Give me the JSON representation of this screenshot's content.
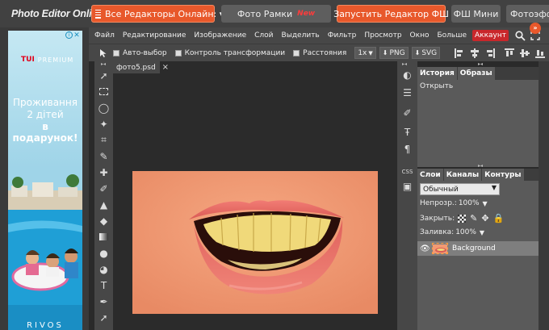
{
  "site": {
    "logo": "Photo Editor Online"
  },
  "topbar": {
    "all_editors": "Все Редакторы Онлайн: ▾",
    "frames": "Фото Рамки",
    "frames_badge": "New",
    "launch": "Запустить Редактор ФШ",
    "mini": "ФШ Мини",
    "effects": "Фотоэфф"
  },
  "ad": {
    "brand_mark": "TUI",
    "brand_text": "PREMIUM",
    "line1": "Проживання",
    "line2": "2 дітей",
    "line3": "в подарунок!",
    "footer": "RIVOS",
    "info": "i",
    "close": "✕"
  },
  "menu": {
    "items": [
      "Файл",
      "Редактирование",
      "Изображение",
      "Слой",
      "Выделить",
      "Фильтр",
      "Просмотр",
      "Окно",
      "Больше"
    ],
    "account": "Аккаунт"
  },
  "options": {
    "auto_select": "Авто-выбор",
    "transform": "Контроль трансформации",
    "distances": "Расстояния",
    "zoom": "1x",
    "png": "PNG",
    "svg": "SVG"
  },
  "document": {
    "tab": "фото5.psd",
    "close": "×"
  },
  "panels": {
    "history_tabs": [
      "История",
      "Образы"
    ],
    "history_items": [
      "Открыть"
    ],
    "layer_tabs": [
      "Слои",
      "Каналы",
      "Контуры"
    ],
    "blend_mode": "Обычный",
    "opacity_label": "Непрозр.:",
    "opacity_value": "100%",
    "lock_label": "Закрыть:",
    "fill_label": "Заливка:",
    "fill_value": "100%",
    "layer_name": "Background"
  },
  "rightcol": {
    "css": "CSS"
  },
  "colors": {
    "accent": "#e8582b",
    "account": "#c9272b",
    "panel": "#5a5a5a",
    "chrome": "#474747"
  }
}
